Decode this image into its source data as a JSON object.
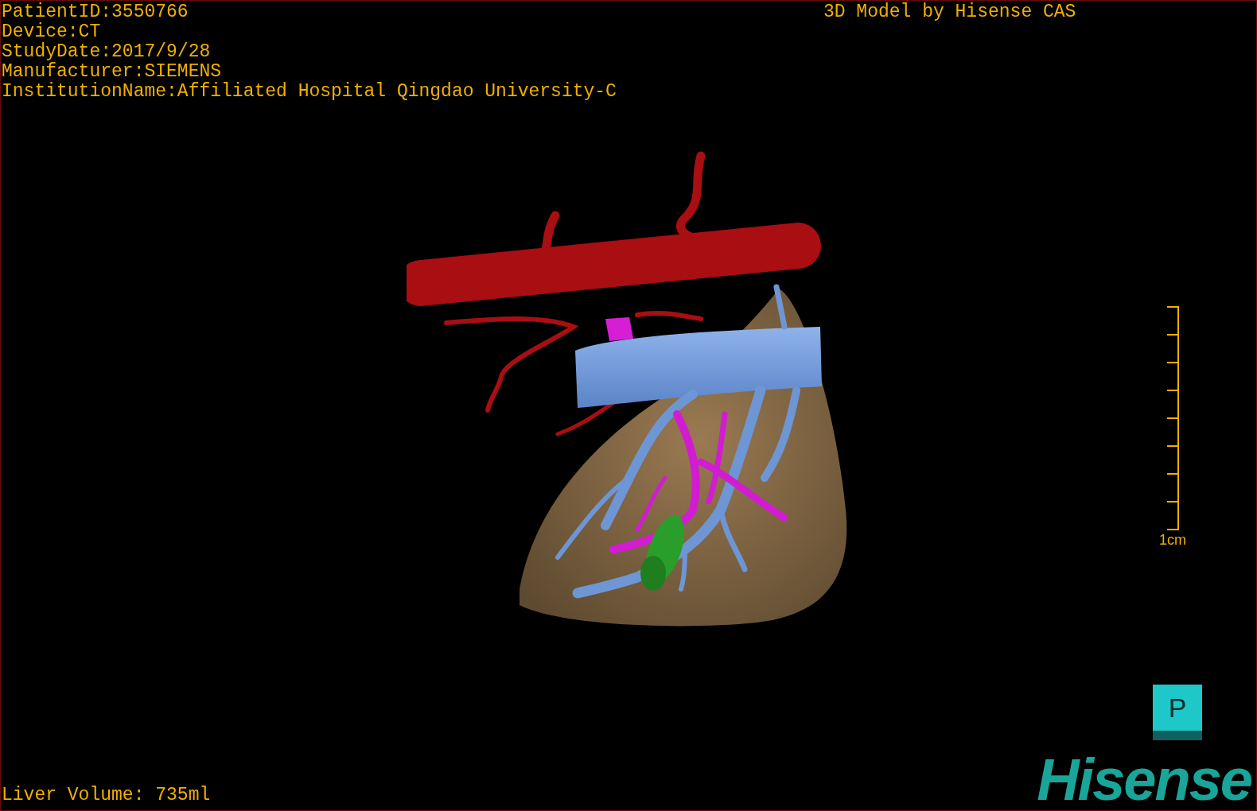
{
  "header": {
    "info_lines": [
      "PatientID:3550766",
      "Device:CT",
      "StudyDate:2017/9/28",
      "Manufacturer:SIEMENS",
      "InstitutionName:Affiliated Hospital Qingdao University-C"
    ],
    "credit": "3D Model by Hisense CAS"
  },
  "scale_bar": {
    "label": "1cm"
  },
  "orientation_cube": {
    "label": "P"
  },
  "logo": "Hisense",
  "footer": {
    "liver_volume": "Liver Volume: 735ml"
  }
}
